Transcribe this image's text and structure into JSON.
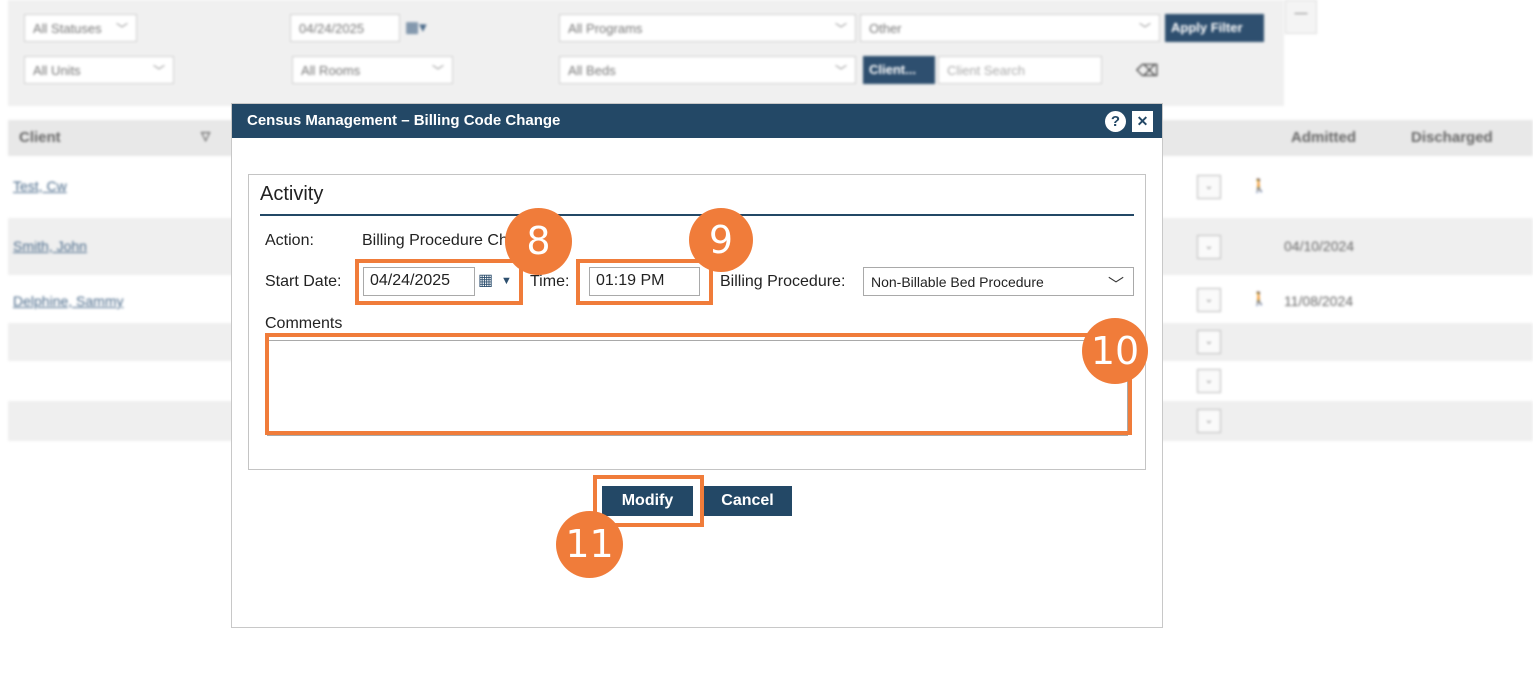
{
  "filters": {
    "status": "All Statuses",
    "date": "04/24/2025",
    "program": "All Programs",
    "other": "Other",
    "apply_label": "Apply Filter",
    "unit": "All Units",
    "room": "All Rooms",
    "bed": "All Beds",
    "client_button": "Client...",
    "client_search_placeholder": "Client Search",
    "collapse_label": "—"
  },
  "grid": {
    "columns": {
      "client": "Client",
      "admitted": "Admitted",
      "discharged": "Discharged"
    },
    "rows": [
      {
        "client": "Test, Cw",
        "admitted": ""
      },
      {
        "client": "Smith, John",
        "admitted": "04/10/2024"
      },
      {
        "client": "Delphine, Sammy",
        "admitted": "11/08/2024"
      }
    ],
    "dropdown_glyph": "⌄",
    "walk_glyph": "🚶"
  },
  "dialog": {
    "title": "Census Management – Billing Code Change",
    "help_glyph": "?",
    "close_glyph": "✕",
    "section_title": "Activity",
    "action_label": "Action:",
    "action_value": "Billing Procedure Ch",
    "start_date_label": "Start Date:",
    "start_date_value": "04/24/2025",
    "time_label": "Time:",
    "time_value": "01:19 PM",
    "billing_label": "Billing Procedure:",
    "billing_value": "Non-Billable Bed Procedure",
    "comments_label": "Comments",
    "comments_value": "",
    "modify_label": "Modify",
    "cancel_label": "Cancel"
  },
  "annotations": {
    "step8": "8",
    "step9": "9",
    "step10": "10",
    "step11": "11"
  },
  "colors": {
    "header": "#234866",
    "highlight": "#f07c3a"
  },
  "icons": {
    "calendar": "calendar-icon",
    "caret": "caret-down-icon",
    "chevron": "chevron-down-icon",
    "eraser": "eraser-icon"
  }
}
